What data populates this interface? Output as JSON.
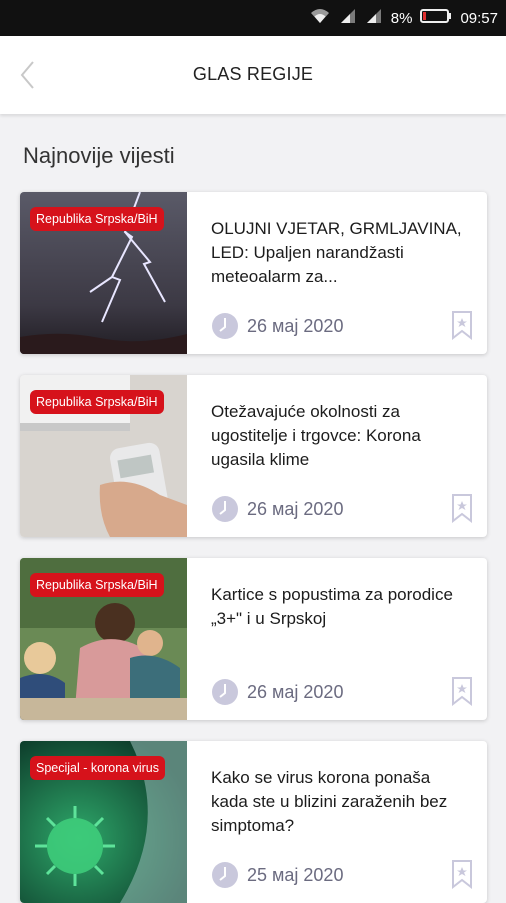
{
  "status": {
    "battery": "8%",
    "time": "09:57"
  },
  "header": {
    "title": "GLAS REGIJE"
  },
  "section": {
    "title": "Najnovije vijesti"
  },
  "articles": [
    {
      "badge": "Republika Srpska/BiH",
      "title": "OLUJNI VJETAR, GRMLJAVINA, LED: Upaljen narandžasti meteoalarm za...",
      "date": "26 мај 2020"
    },
    {
      "badge": "Republika Srpska/BiH",
      "title": "Otežavajuće okolnosti za ugostitelje i trgovce: Korona ugasila klime",
      "date": "26 мај 2020"
    },
    {
      "badge": "Republika Srpska/BiH",
      "title": "Kartice s popustima za porodice „3+\" i u Srpskoj",
      "date": "26 мај 2020"
    },
    {
      "badge": "Specijal - korona virus",
      "title": "Kako se virus korona ponaša kada ste u blizini zaraženih bez simptoma?",
      "date": "25 мај 2020"
    }
  ],
  "colors": {
    "badge": "#d6121b",
    "accent": "#6b6b80",
    "clock": "#c9c8dc",
    "bookmark": "#c9c8dc"
  },
  "icons": [
    "wifi-icon",
    "signal-icon",
    "battery-icon",
    "back-arrow-icon",
    "clock-icon",
    "bookmark-icon"
  ]
}
